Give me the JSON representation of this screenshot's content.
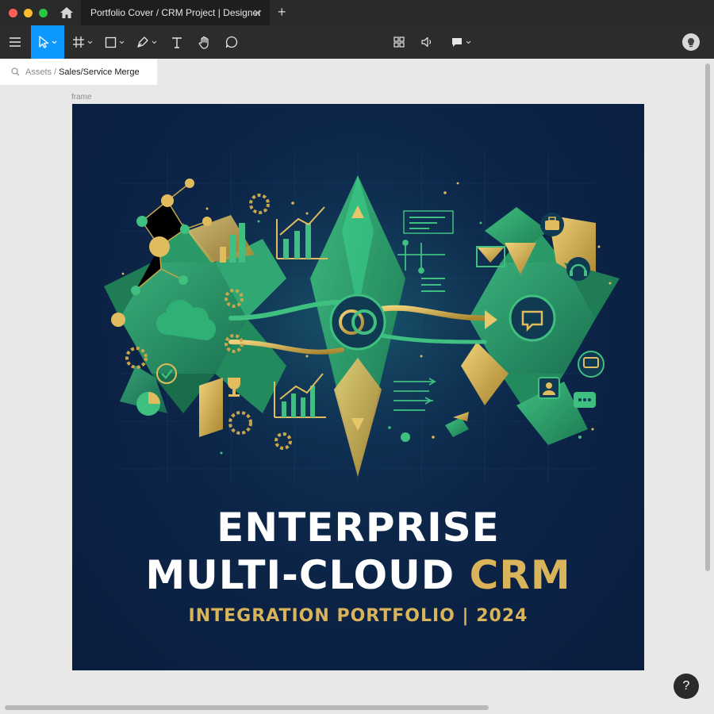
{
  "window": {
    "tab_title": "Portfolio Cover / CRM Project | Designer",
    "tab_close": "✕",
    "tab_add": "+",
    "traffic_colors": [
      "#ff5f57",
      "#febc2e",
      "#28c840"
    ]
  },
  "toolbar": {
    "tools": [
      "menu-icon",
      "move-tool-icon",
      "frame-tool-icon",
      "shape-tool-icon",
      "pen-tool-icon",
      "text-tool-icon",
      "hand-tool-icon",
      "comment-tool-icon"
    ],
    "center_tools": [
      "components-icon",
      "audio-icon",
      "present-icon"
    ],
    "accent": "#0d99ff"
  },
  "breadcrumb": {
    "root": "Assets",
    "separator": "/",
    "current": "Sales/Service Merge"
  },
  "canvas": {
    "frame_label": "frame"
  },
  "artwork": {
    "headline_line1": "ENTERPRISE",
    "headline_line2_white": "MULTI-CLOUD ",
    "headline_line2_gold": "CRM",
    "subtitle": "INTEGRATION PORTFOLIO | 2024",
    "colors": {
      "navy": "#0a1d3e",
      "green": "#2e9e6a",
      "gold": "#d9b45a"
    }
  },
  "help": {
    "label": "?"
  }
}
